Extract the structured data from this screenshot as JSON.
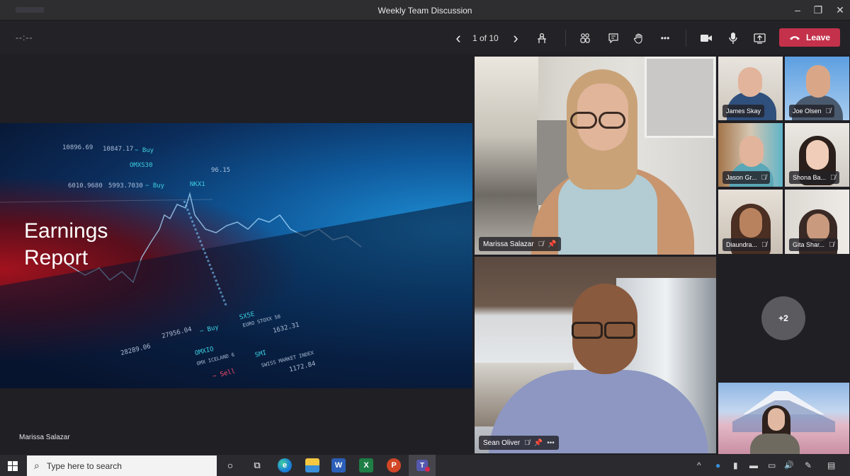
{
  "window": {
    "title": "Weekly Team Discussion",
    "controls": {
      "minimize": "–",
      "restore": "❐",
      "close": "✕"
    }
  },
  "toolbar": {
    "timer": "--:--",
    "prev_icon": "‹",
    "page_indicator": "1 of 10",
    "next_icon": "›",
    "presenter_view_icon": "presenter-icon",
    "participants_icon": "people-icon",
    "chat_icon": "chat-icon",
    "raise_hand_icon": "hand-icon",
    "more_label": "•••",
    "camera_icon": "camera-icon",
    "mic_icon": "mic-icon",
    "share_icon": "share-icon",
    "leave_label": "Leave",
    "leave_color": "#c4314b"
  },
  "presentation": {
    "slide_title_line1": "Earnings",
    "slide_title_line2": "Report",
    "tickers": [
      "10896.69",
      "10847.17",
      "~ Buy",
      "OMXS30",
      "5993.7030",
      "~ Buy",
      "NKX1",
      "96.15",
      "27956.04",
      "~ Buy",
      "28289.06",
      "OMXIO",
      "OMX ICELAND 6",
      "~ Sell",
      "SX5E",
      "EURO STOXX 50",
      "1632.31",
      "SMI",
      "SWISS MARKET INDEX",
      "1172.84",
      "6010.9680"
    ],
    "presenter_name": "Marissa Salazar"
  },
  "participants": {
    "large": [
      {
        "name": "Marissa Salazar",
        "mic_icon": "mic-off-icon",
        "pin_icon": "pin-icon",
        "more": ""
      },
      {
        "name": "Sean Oliver",
        "mic_icon": "mic-off-icon",
        "pin_icon": "pin-icon",
        "more": "•••"
      }
    ],
    "small": [
      {
        "name": "James Skay",
        "muted": false
      },
      {
        "name": "Joe Olsen",
        "muted": true
      },
      {
        "name": "Jason Gr...",
        "muted": true
      },
      {
        "name": "Shona Ba...",
        "muted": true
      },
      {
        "name": "Diaundra...",
        "muted": true
      },
      {
        "name": "Gita Shar...",
        "muted": true
      }
    ],
    "overflow_count": "+2"
  },
  "taskbar": {
    "search_placeholder": "Type here to search",
    "apps": [
      {
        "name": "cortana",
        "glyph": "○"
      },
      {
        "name": "task-view",
        "glyph": "⧉"
      },
      {
        "name": "edge",
        "glyph": "e"
      },
      {
        "name": "file-explorer",
        "glyph": "▭"
      },
      {
        "name": "word",
        "glyph": "W"
      },
      {
        "name": "excel",
        "glyph": "X"
      },
      {
        "name": "powerpoint",
        "glyph": "P"
      },
      {
        "name": "teams",
        "glyph": "T"
      }
    ],
    "tray": [
      "^",
      "●",
      "▮",
      "▬",
      "▭",
      "🔊",
      "✎",
      "▤"
    ]
  }
}
